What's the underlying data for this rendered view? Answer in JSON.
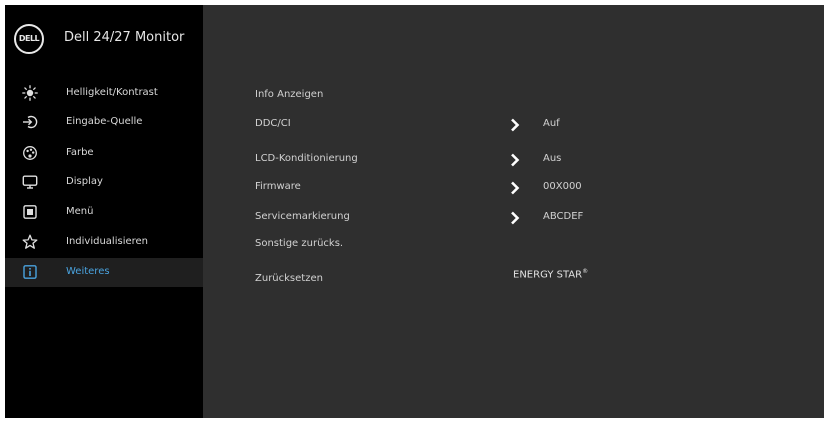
{
  "header": {
    "logo_text": "DELL",
    "title": "Dell 24/27 Monitor"
  },
  "sidebar": {
    "items": [
      {
        "label": "Helligkeit/Kontrast",
        "icon": "brightness-icon",
        "active": false
      },
      {
        "label": "Eingabe-Quelle",
        "icon": "input-source-icon",
        "active": false
      },
      {
        "label": "Farbe",
        "icon": "color-icon",
        "active": false
      },
      {
        "label": "Display",
        "icon": "display-icon",
        "active": false
      },
      {
        "label": "Menü",
        "icon": "menu-icon",
        "active": false
      },
      {
        "label": "Individualisieren",
        "icon": "star-icon",
        "active": false
      },
      {
        "label": "Weiteres",
        "icon": "info-icon",
        "active": true
      }
    ]
  },
  "main": {
    "rows": [
      {
        "label": "Info Anzeigen",
        "value": ""
      },
      {
        "label": "DDC/CI",
        "value": "Auf"
      },
      {
        "label": "LCD-Konditionierung",
        "value": "Aus"
      },
      {
        "label": "Firmware",
        "value": "00X000"
      },
      {
        "label": "Servicemarkierung",
        "value": "ABCDEF"
      },
      {
        "label": "Sonstige zurücks.",
        "value": ""
      },
      {
        "label": "Zurücksetzen",
        "value": ""
      }
    ],
    "energy_star": "ENERGY STAR",
    "energy_star_mark": "®"
  },
  "colors": {
    "sidebar_bg": "#000000",
    "panel_bg": "#2f2f2f",
    "active_item_bg": "#1f1f1f",
    "active_accent": "#4aa3df",
    "text": "#d2d2d2"
  }
}
